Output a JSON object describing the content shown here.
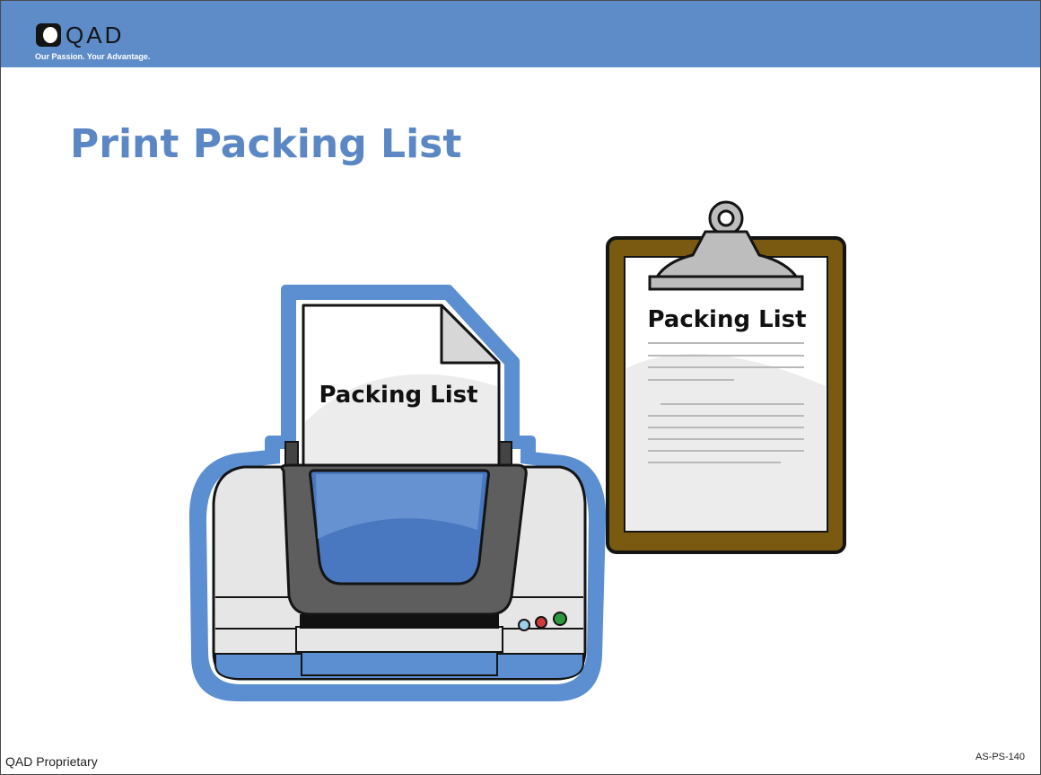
{
  "header": {
    "brand": "QAD",
    "tagline": "Our Passion. Your Advantage."
  },
  "slide": {
    "title": "Print Packing List",
    "printed_page_text": "Packing List",
    "clipboard_text": "Packing List"
  },
  "footer": {
    "left": "QAD Proprietary",
    "right": "AS-PS-140"
  },
  "icons": [
    "qad-logo-icon",
    "printer-icon",
    "document-icon",
    "clipboard-icon"
  ],
  "colors": {
    "header": "#5e8cc9",
    "title": "#5b88c5",
    "printer_outline": "#5b8fd1",
    "clipboard_board": "#7a5a10"
  }
}
